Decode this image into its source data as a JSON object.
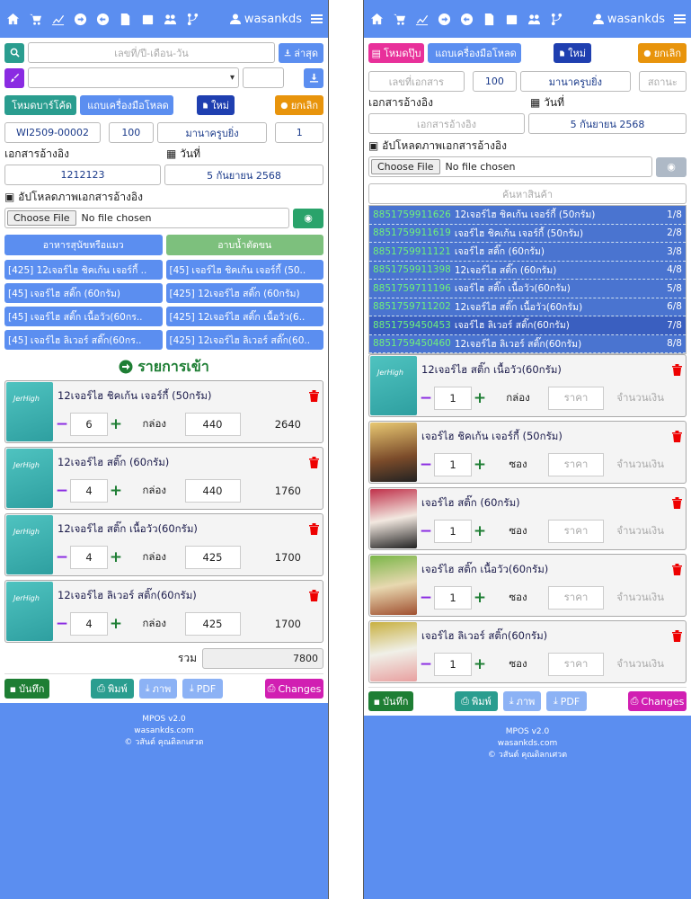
{
  "user": {
    "name": "wasankds"
  },
  "left": {
    "search_placeholder": "เลขที่/ปี-เดือน-วัน",
    "latest_btn": "ล่าสุด",
    "barcode_btn": "โหมดบาร์โค้ด",
    "toolbar_btn": "แถบเครื่องมือโหลด",
    "new_btn": "ใหม่",
    "cancel_btn": "ยกเลิก",
    "doc_no": "WI2509-00002",
    "doc_qty": "100",
    "doc_supplier": "มานาครูบยิ่ง",
    "doc_status": "1",
    "ref_label": "เอกสารอ้างอิง",
    "date_label": "วันที่",
    "ref_value": "1212123",
    "date_value": "5 กันยายน 2568",
    "upload_label": "อัปโหลดภาพเอกสารอ้างอิง",
    "choose_file": "Choose File",
    "no_file": "No file chosen",
    "categories": [
      "อาหารสุนัขหรือแมว",
      "อาบน้ำตัดขน"
    ],
    "products": [
      "[425] 12เจอร์ไฮ ชิคเก้น เจอร์กี้ ..",
      "[45] เจอร์ไฮ ชิคเก้น เจอร์กี้ (50..",
      "[45] เจอร์ไฮ สติ๊ก (60กรัม)",
      "[425] 12เจอร์ไฮ สติ๊ก (60กรัม)",
      "[45] เจอร์ไฮ สติ๊ก เนื้อวัว(60กร..",
      "[425] 12เจอร์ไฮ สติ๊ก เนื้อวัว(6..",
      "[45] เจอร์ไฮ ลิเวอร์ สติ๊ก(60กร..",
      "[425] 12เจอร์ไฮ ลิเวอร์ สติ๊ก(60.."
    ],
    "section_title": "รายการเข้า",
    "items": [
      {
        "name": "12เจอร์ไฮ ชิคเก้น เจอร์กี้ (50กรัม)",
        "qty": "6",
        "unit": "กล่อง",
        "price": "440",
        "total": "2640"
      },
      {
        "name": "12เจอร์ไฮ สติ๊ก (60กรัม)",
        "qty": "4",
        "unit": "กล่อง",
        "price": "440",
        "total": "1760"
      },
      {
        "name": "12เจอร์ไฮ สติ๊ก เนื้อวัว(60กรัม)",
        "qty": "4",
        "unit": "กล่อง",
        "price": "425",
        "total": "1700"
      },
      {
        "name": "12เจอร์ไฮ ลิเวอร์ สติ๊ก(60กรัม)",
        "qty": "4",
        "unit": "กล่อง",
        "price": "425",
        "total": "1700"
      }
    ],
    "sum_label": "รวม",
    "sum_value": "7800",
    "save_btn": "บันทึก",
    "print_btn": "พิมพ์",
    "image_btn": "ภาพ",
    "pdf_btn": "PDF",
    "changes_btn": "Changes"
  },
  "right": {
    "popup_btn": "โหมดปุ๊บ",
    "toolbar_btn": "แถบเครื่องมือโหลด",
    "new_btn": "ใหม่",
    "cancel_btn": "ยกเลิก",
    "doc_no_placeholder": "เลขที่เอกสาร",
    "doc_qty": "100",
    "doc_supplier": "มานาครูบยิ่ง",
    "doc_status_placeholder": "สถานะ",
    "ref_label": "เอกสารอ้างอิง",
    "date_label": "วันที่",
    "ref_placeholder": "เอกสารอ้างอิง",
    "date_value": "5 กันยายน 2568",
    "upload_label": "อัปโหลดภาพเอกสารอ้างอิง",
    "choose_file": "Choose File",
    "no_file": "No file chosen",
    "search_placeholder": "ค้นหาสินค้า",
    "dropdown": [
      {
        "code": "8851759911626",
        "name": "12เจอร์ไฮ ชิคเก้น เจอร์กี้ (50กรัม)",
        "idx": "1/8"
      },
      {
        "code": "8851759911619",
        "name": "เจอร์ไฮ ชิคเก้น เจอร์กี้ (50กรัม)",
        "idx": "2/8"
      },
      {
        "code": "8851759911121",
        "name": "เจอร์ไฮ สติ๊ก (60กรัม)",
        "idx": "3/8"
      },
      {
        "code": "8851759911398",
        "name": "12เจอร์ไฮ สติ๊ก (60กรัม)",
        "idx": "4/8"
      },
      {
        "code": "8851759711196",
        "name": "เจอร์ไฮ สติ๊ก เนื้อวัว(60กรัม)",
        "idx": "5/8"
      },
      {
        "code": "8851759711202",
        "name": "12เจอร์ไฮ สติ๊ก เนื้อวัว(60กรัม)",
        "idx": "6/8"
      },
      {
        "code": "8851759450453",
        "name": "เจอร์ไฮ ลิเวอร์ สติ๊ก(60กรัม)",
        "idx": "7/8"
      },
      {
        "code": "8851759450460",
        "name": "12เจอร์ไฮ ลิเวอร์ สติ๊ก(60กรัม)",
        "idx": "8/8"
      }
    ],
    "items": [
      {
        "name": "12เจอร์ไฮ สติ๊ก เนื้อวัว(60กรัม)",
        "qty": "1",
        "unit": "กล่อง",
        "price": "ราคา",
        "total": "จำนวนเงิน",
        "img": "box"
      },
      {
        "name": "เจอร์ไฮ ชิคเก้น เจอร์กี้ (50กรัม)",
        "qty": "1",
        "unit": "ซอง",
        "price": "ราคา",
        "total": "จำนวนเงิน",
        "img": "dog1"
      },
      {
        "name": "เจอร์ไฮ สติ๊ก (60กรัม)",
        "qty": "1",
        "unit": "ซอง",
        "price": "ราคา",
        "total": "จำนวนเงิน",
        "img": "dog2"
      },
      {
        "name": "เจอร์ไฮ สติ๊ก เนื้อวัว(60กรัม)",
        "qty": "1",
        "unit": "ซอง",
        "price": "ราคา",
        "total": "จำนวนเงิน",
        "img": "dog3"
      },
      {
        "name": "เจอร์ไฮ ลิเวอร์ สติ๊ก(60กรัม)",
        "qty": "1",
        "unit": "ซอง",
        "price": "ราคา",
        "total": "จำนวนเงิน",
        "img": "dog4"
      }
    ],
    "save_btn": "บันทึก",
    "print_btn": "พิมพ์",
    "image_btn": "ภาพ",
    "pdf_btn": "PDF",
    "changes_btn": "Changes"
  },
  "footer": {
    "line1": "MPOS v2.0",
    "line2": "wasankds.com",
    "line3": "วสันต์ คุณดิลกเศวต"
  }
}
